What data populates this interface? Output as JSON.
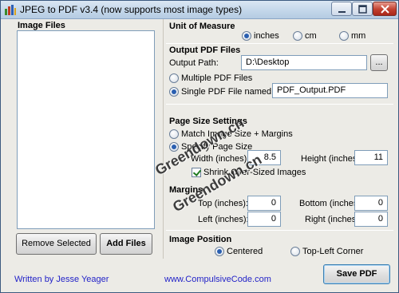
{
  "titlebar": {
    "title": "JPEG to PDF  v3.4    (now supports most image types)"
  },
  "image_files": {
    "header": "Image Files",
    "remove_selected": "Remove Selected",
    "add_files": "Add Files"
  },
  "unit_of_measure": {
    "header": "Unit of Measure",
    "options": [
      "inches",
      "cm",
      "mm"
    ],
    "selected": "inches"
  },
  "output": {
    "header": "Output PDF Files",
    "path_label": "Output Path:",
    "path_value": "D:\\Desktop",
    "browse_label": "...",
    "multiple_label": "Multiple PDF Files",
    "single_label": "Single PDF File named:",
    "single_filename": "PDF_Output.PDF",
    "selected": "single"
  },
  "page_size": {
    "header": "Page Size Settings",
    "match_label": "Match Image Size + Margins",
    "specify_label": "Specify Page Size",
    "width_label": "Width (inches):",
    "width_value": "8.5",
    "height_label": "Height (inches):",
    "height_value": "11",
    "shrink_label": "Shrink Over-Sized Images",
    "shrink_checked": true,
    "selected": "specify"
  },
  "margins": {
    "header": "Margins",
    "top_label": "Top (inches):",
    "top_value": "0",
    "bottom_label": "Bottom (inches):",
    "bottom_value": "0",
    "left_label": "Left (inches):",
    "left_value": "0",
    "right_label": "Right (inches):",
    "right_value": "0"
  },
  "image_position": {
    "header": "Image Position",
    "centered_label": "Centered",
    "topleft_label": "Top-Left Corner",
    "selected": "centered"
  },
  "footer": {
    "author": "Written by Jesse Yeager",
    "website": "www.CompulsiveCode.com",
    "save_pdf": "Save PDF"
  },
  "watermark": {
    "text1": "Greendown.cn",
    "text2": "Greendown.cn"
  },
  "colors": {
    "link": "#2323c8",
    "radio_selected": "#2a5fb0",
    "panel_bg": "#ecebe6"
  }
}
